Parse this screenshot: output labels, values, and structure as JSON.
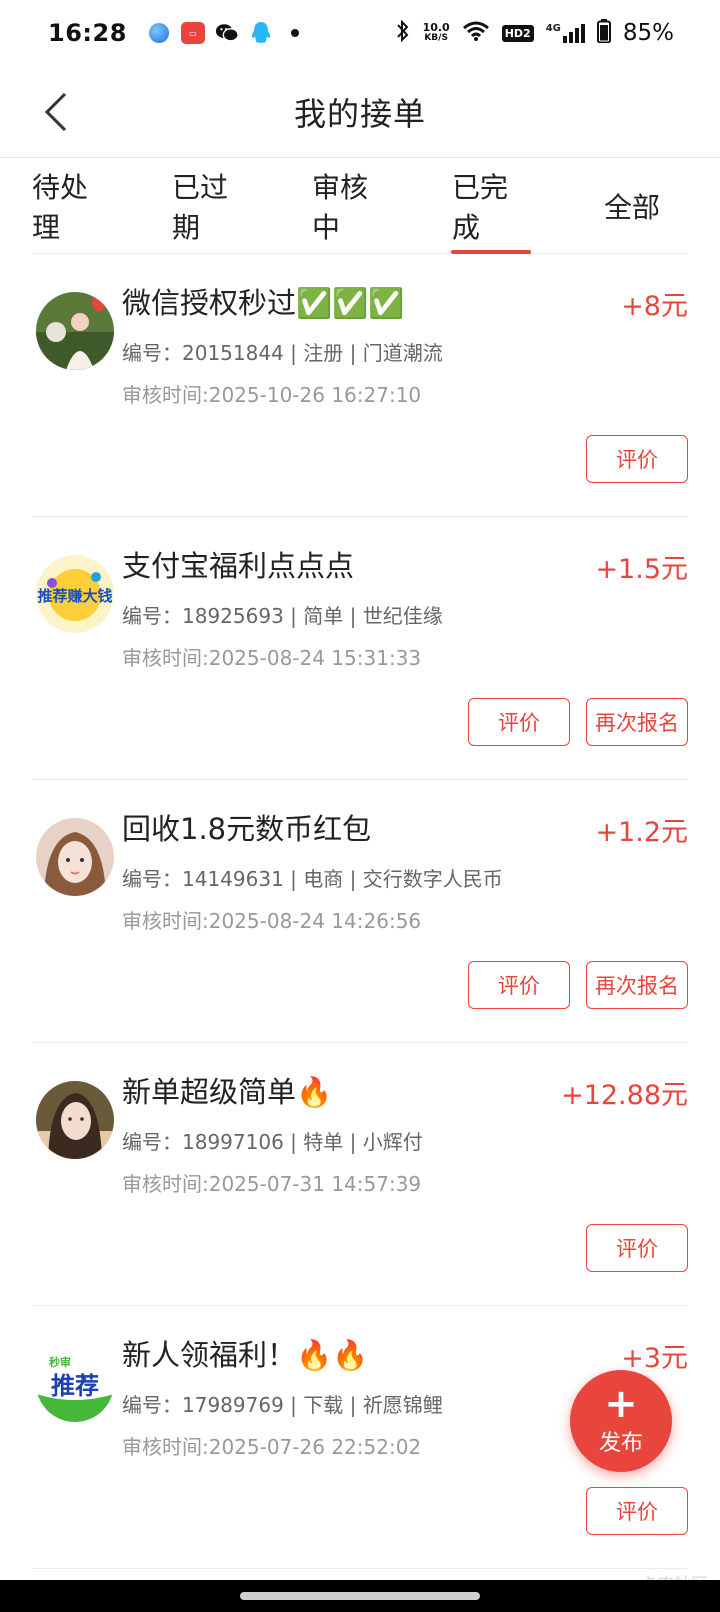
{
  "status_bar": {
    "time": "16:28",
    "net_speed_value": "10.0",
    "net_speed_unit": "KB/S",
    "hd_label": "HD2",
    "signal_label": "4G",
    "battery": "85%",
    "icons": [
      "browser-icon",
      "shopping-app-icon",
      "wechat-icon",
      "qq-icon",
      "notification-dot-icon",
      "bluetooth-icon",
      "wifi-icon",
      "signal-icon",
      "battery-icon"
    ]
  },
  "header": {
    "title": "我的接单",
    "back_icon": "chevron-left-icon"
  },
  "tabs": [
    {
      "label": "待处理",
      "active": false
    },
    {
      "label": "已过期",
      "active": false
    },
    {
      "label": "审核中",
      "active": false
    },
    {
      "label": "已完成",
      "active": true
    },
    {
      "label": "全部",
      "active": false
    }
  ],
  "orders": [
    {
      "title": "微信授权秒过✅✅✅",
      "reward": "+8元",
      "meta": "编号：20151844 | 注册 | 门道潮流",
      "review_time": "审核时间:2025-10-26 16:27:10",
      "buttons": [
        "评价"
      ]
    },
    {
      "title": "支付宝福利点点点",
      "reward": "+1.5元",
      "meta": "编号：18925693 | 简单 | 世纪佳缘",
      "review_time": "审核时间:2025-08-24 15:31:33",
      "buttons": [
        "评价",
        "再次报名"
      ]
    },
    {
      "title": "回收1.8元数币红包",
      "reward": "+1.2元",
      "meta": "编号：14149631 | 电商 | 交行数字人民币",
      "review_time": "审核时间:2025-08-24 14:26:56",
      "buttons": [
        "评价",
        "再次报名"
      ]
    },
    {
      "title": "新单超级简单🔥",
      "reward": "+12.88元",
      "meta": "编号：18997106 | 特单 | 小辉付",
      "review_time": "审核时间:2025-07-31 14:57:39",
      "buttons": [
        "评价"
      ]
    },
    {
      "title": "新人领福利！🔥🔥",
      "reward": "+3元",
      "meta": "编号：17989769 | 下载 | 祈愿锦鲤",
      "review_time": "审核时间:2025-07-26 22:52:02",
      "buttons": [
        "评价"
      ]
    }
  ],
  "avatar_texts": {
    "avatar2": "推荐赚大钱",
    "avatar5_top": "秒审",
    "avatar5_main": "推荐"
  },
  "fab": {
    "symbol": "+",
    "label": "发布"
  },
  "watermark": "卡农社区",
  "colors": {
    "accent": "#e8453c",
    "text_primary": "#222222",
    "text_secondary": "#666666",
    "text_muted": "#999999",
    "divider": "#ececec"
  }
}
